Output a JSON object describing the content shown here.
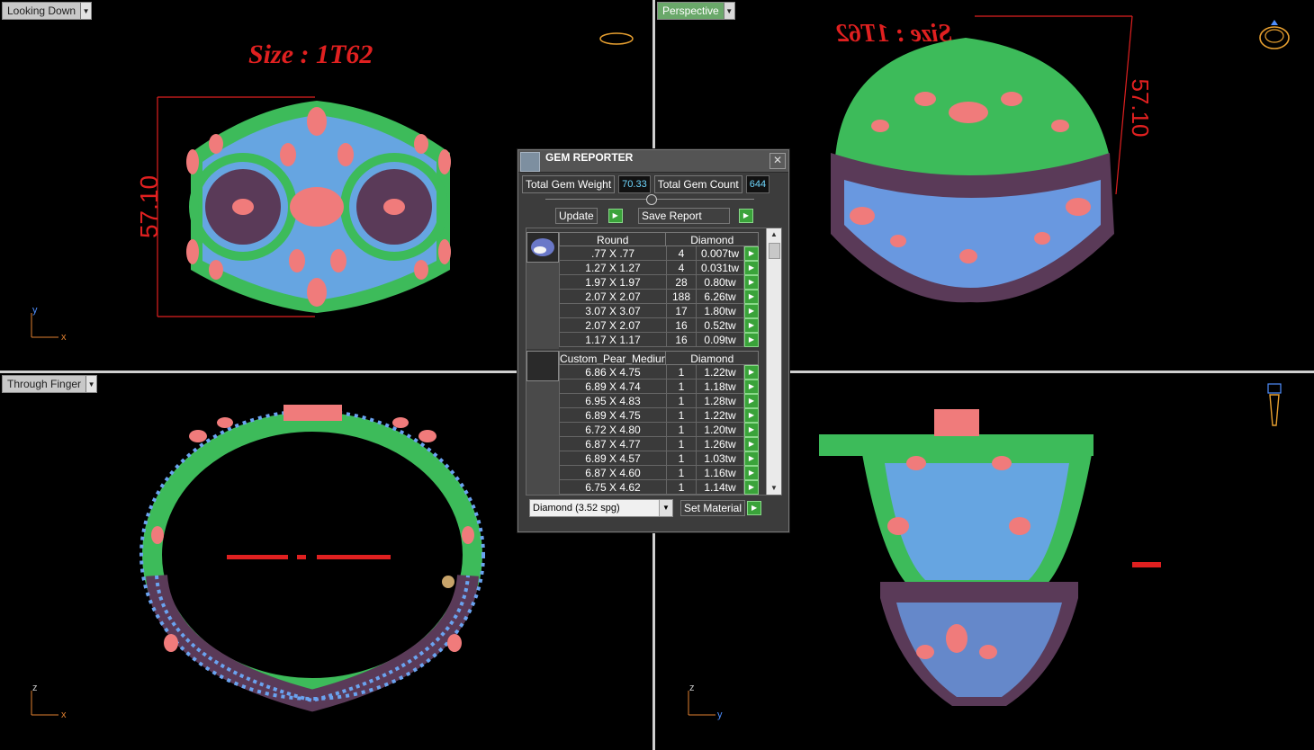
{
  "viewports": {
    "top_left": {
      "label": "Looking Down",
      "size_text": "Size : 1T62",
      "dimension": "57.10",
      "axis": [
        "y",
        "x"
      ]
    },
    "top_right": {
      "label": "Perspective",
      "dimension": "57.10",
      "size_text": "Size : 1T62"
    },
    "bottom_left": {
      "label": "Through Finger",
      "axis": [
        "z",
        "x"
      ]
    },
    "bottom_right": {
      "axis": [
        "z",
        "y"
      ]
    }
  },
  "gem_reporter": {
    "title": "GEM REPORTER",
    "close": "✕",
    "total_weight_label": "Total Gem Weight",
    "total_weight": "70.33",
    "total_count_label": "Total Gem Count",
    "total_count": "644",
    "update_label": "Update",
    "save_label": "Save Report",
    "groups": [
      {
        "shape": "Round",
        "material": "Diamond",
        "rows": [
          {
            "size": ".77 X .77",
            "count": "4",
            "weight": "0.007tw"
          },
          {
            "size": "1.27 X 1.27",
            "count": "4",
            "weight": "0.031tw"
          },
          {
            "size": "1.97 X 1.97",
            "count": "28",
            "weight": "0.80tw"
          },
          {
            "size": "2.07 X 2.07",
            "count": "188",
            "weight": "6.26tw"
          },
          {
            "size": "3.07 X 3.07",
            "count": "17",
            "weight": "1.80tw"
          },
          {
            "size": "2.07 X 2.07",
            "count": "16",
            "weight": "0.52tw"
          },
          {
            "size": "1.17 X 1.17",
            "count": "16",
            "weight": "0.09tw"
          }
        ]
      },
      {
        "shape": "Custom_Pear_Medium",
        "material": "Diamond",
        "rows": [
          {
            "size": "6.86 X 4.75",
            "count": "1",
            "weight": "1.22tw"
          },
          {
            "size": "6.89 X 4.74",
            "count": "1",
            "weight": "1.18tw"
          },
          {
            "size": "6.95 X 4.83",
            "count": "1",
            "weight": "1.28tw"
          },
          {
            "size": "6.89 X 4.75",
            "count": "1",
            "weight": "1.22tw"
          },
          {
            "size": "6.72 X 4.80",
            "count": "1",
            "weight": "1.20tw"
          },
          {
            "size": "6.87 X 4.77",
            "count": "1",
            "weight": "1.26tw"
          },
          {
            "size": "6.89 X 4.57",
            "count": "1",
            "weight": "1.03tw"
          },
          {
            "size": "6.87 X 4.60",
            "count": "1",
            "weight": "1.16tw"
          },
          {
            "size": "6.75 X 4.62",
            "count": "1",
            "weight": "1.14tw"
          }
        ]
      }
    ],
    "material_select": "Diamond    (3.52 spg)",
    "set_material_label": "Set Material"
  },
  "colors": {
    "metal_green": "#3dbb5a",
    "stone_blue": "#6aa3f0",
    "stone_pink": "#f07b7b",
    "shank_purple": "#5a3a58",
    "dimension_red": "#e02020"
  }
}
